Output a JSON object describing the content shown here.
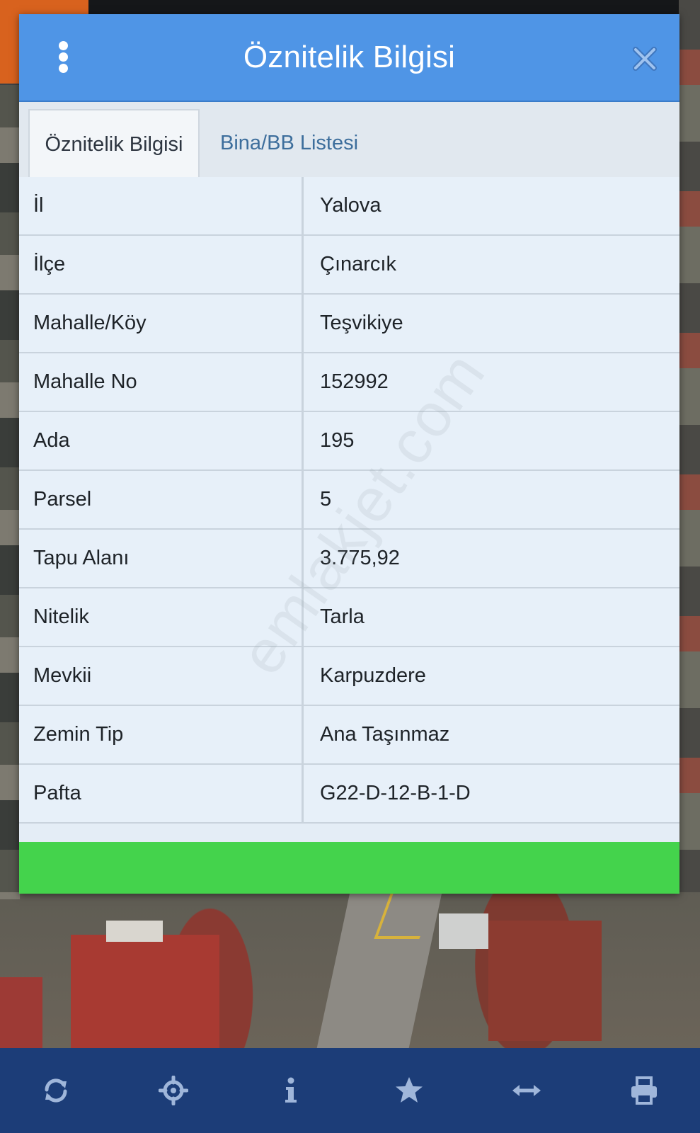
{
  "dialog": {
    "title": "Öznitelik Bilgisi",
    "menu_icon": "kebab-menu-icon",
    "close_icon": "close-icon",
    "tabs": [
      {
        "label": "Öznitelik Bilgisi",
        "active": true
      },
      {
        "label": "Bina/BB Listesi",
        "active": false
      }
    ],
    "rows": [
      {
        "key": "İl",
        "value": "Yalova"
      },
      {
        "key": "İlçe",
        "value": "Çınarcık"
      },
      {
        "key": "Mahalle/Köy",
        "value": "Teşvikiye"
      },
      {
        "key": "Mahalle No",
        "value": "152992"
      },
      {
        "key": "Ada",
        "value": "195"
      },
      {
        "key": "Parsel",
        "value": "5"
      },
      {
        "key": "Tapu Alanı",
        "value": "3.775,92"
      },
      {
        "key": "Nitelik",
        "value": "Tarla"
      },
      {
        "key": "Mevkii",
        "value": "Karpuzdere"
      },
      {
        "key": "Zemin Tip",
        "value": "Ana Taşınmaz"
      },
      {
        "key": "Pafta",
        "value": "G22-D-12-B-1-D"
      }
    ]
  },
  "watermark": "emlakjet.com",
  "toolbar": {
    "items": [
      "refresh-icon",
      "locate-icon",
      "info-icon",
      "star-icon",
      "measure-arrows-icon",
      "print-icon"
    ]
  },
  "colors": {
    "header_blue": "#4f95e6",
    "toolbar_navy": "#1c3d78",
    "status_green": "#44d34c",
    "icon_light": "#9fb6da"
  }
}
